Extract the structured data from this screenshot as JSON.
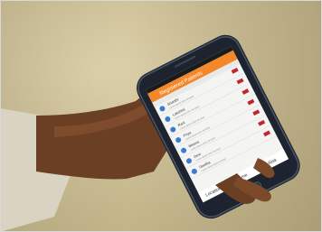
{
  "phone": {
    "app_title": "Registered Patients",
    "list_items": [
      {
        "name": "Shanthi",
        "sub": "Lorem ipsum dolor sit amet"
      },
      {
        "name": "Lakshmi",
        "sub": "Lorem ipsum dolor sit amet"
      },
      {
        "name": "Rani",
        "sub": "Lorem ipsum dolor sit amet"
      },
      {
        "name": "Priya",
        "sub": "Lorem ipsum dolor sit amet"
      },
      {
        "name": "Meena",
        "sub": "Lorem ipsum dolor sit amet"
      },
      {
        "name": "Devi",
        "sub": "Lorem ipsum dolor sit amet"
      },
      {
        "name": "Geetha",
        "sub": "Lorem ipsum dolor sit amet"
      }
    ],
    "bottom_tabs": [
      {
        "label": "Location"
      },
      {
        "label": "Name"
      },
      {
        "label": "Risk"
      }
    ]
  },
  "colors": {
    "wall": "#cbbd93",
    "skin": "#6b3f24",
    "sleeve": "#d9d3c2",
    "phone_body": "#1d2430",
    "app_bar": "#f2882a",
    "risk_red": "#c0262b"
  }
}
